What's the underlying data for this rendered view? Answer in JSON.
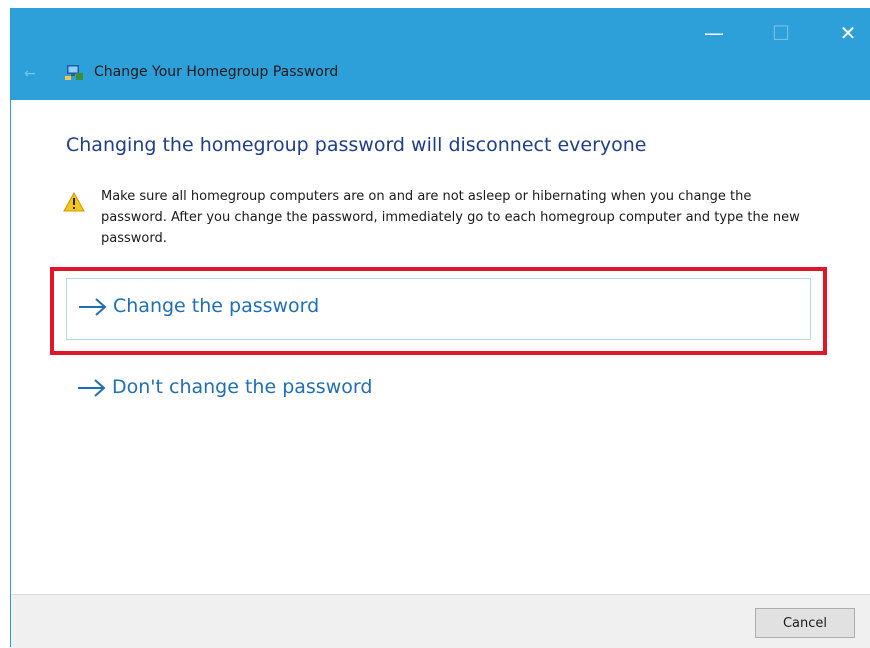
{
  "window": {
    "title": "Change Your Homegroup Password",
    "controls": {
      "minimize": "—",
      "maximize": "☐",
      "close": "✕"
    },
    "back_icon": "←"
  },
  "main": {
    "heading": "Changing the homegroup password will disconnect everyone",
    "warning": "Make sure all homegroup computers are on and are not asleep or hibernating when you change the password. After you change the password, immediately go to each homegroup computer and type the new password.",
    "options": [
      {
        "label": "Change the password",
        "icon": "arrow-right-icon"
      },
      {
        "label": "Don't change the password",
        "icon": "arrow-right-icon"
      }
    ]
  },
  "footer": {
    "cancel_label": "Cancel"
  },
  "colors": {
    "titlebar": "#2d9fd9",
    "heading": "#1e3d8c",
    "link": "#1f6fb6",
    "highlight": "#e0162b"
  }
}
